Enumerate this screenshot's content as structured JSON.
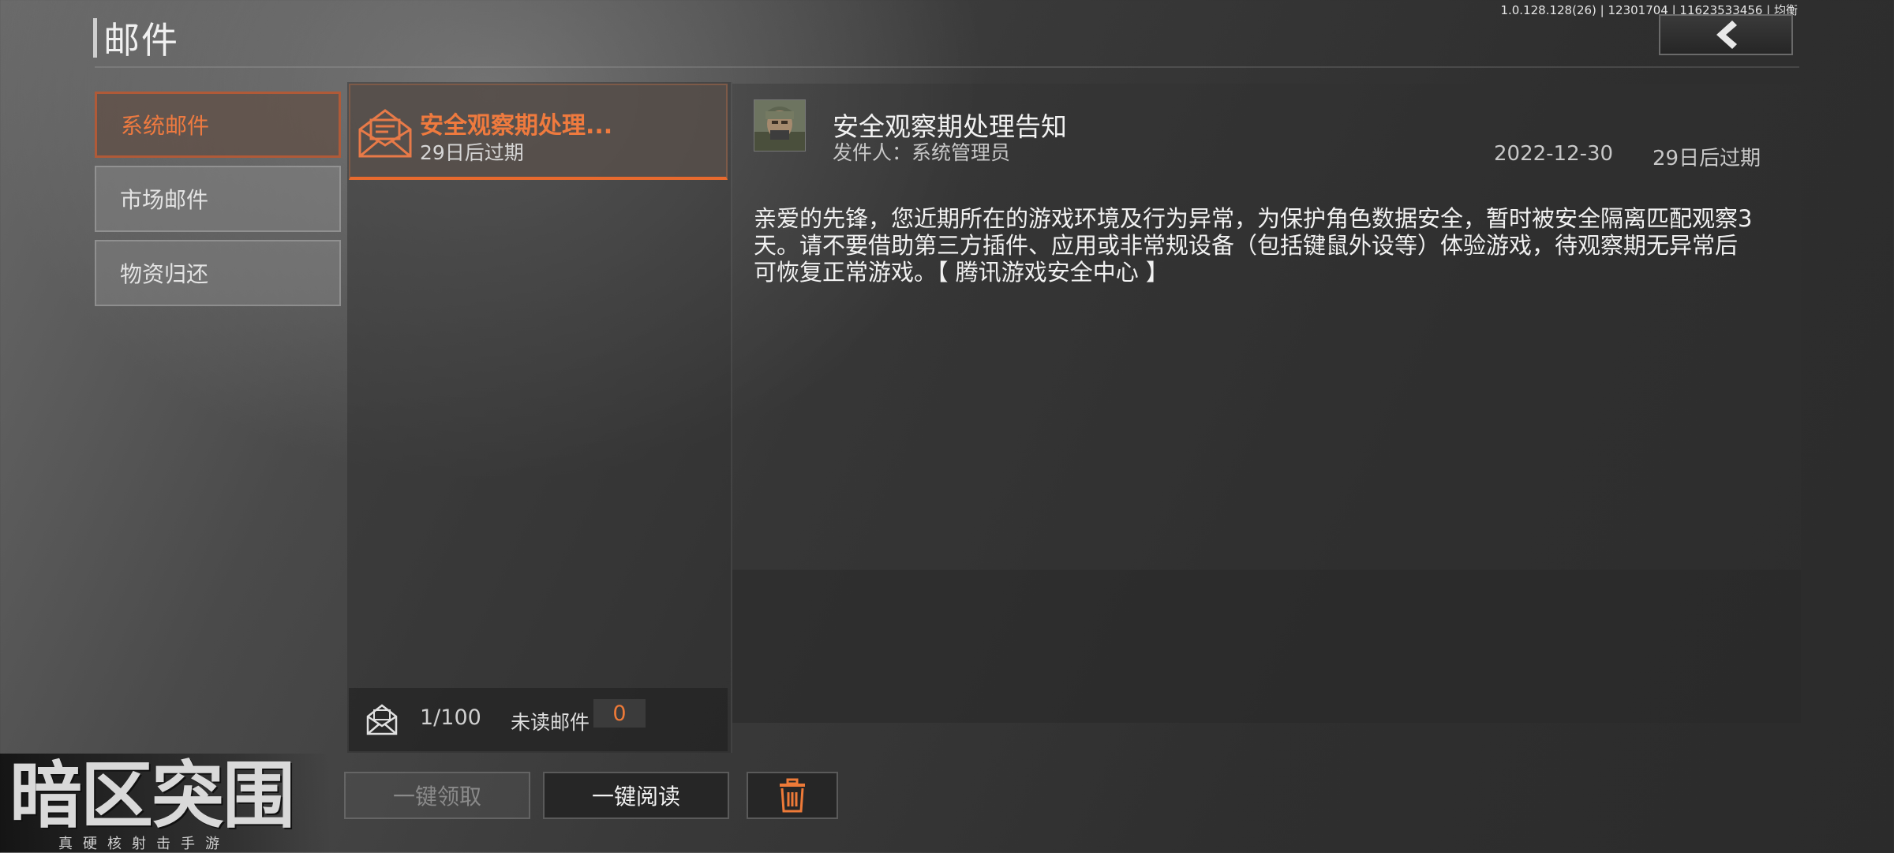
{
  "header": {
    "title": "邮件",
    "version": "1.0.128.128(26) | 12301704 | 11623533456 | 均衡"
  },
  "tabs": [
    {
      "label": "系统邮件",
      "active": true
    },
    {
      "label": "市场邮件",
      "active": false
    },
    {
      "label": "物资归还",
      "active": false
    }
  ],
  "mail_list": {
    "items": [
      {
        "title": "安全观察期处理...",
        "expiry": "29日后过期",
        "selected": true
      }
    ],
    "footer": {
      "count": "1/100",
      "unread_label": "未读邮件",
      "unread_count": "0"
    }
  },
  "detail": {
    "title": "安全观察期处理告知",
    "sender": "发件人：系统管理员",
    "date": "2022-12-30",
    "expiry": "29日后过期",
    "body": "亲爱的先锋，您近期所在的游戏环境及行为异常，为保护角色数据安全，暂时被安全隔离匹配观察3天。请不要借助第三方插件、应用或非常规设备（包括键鼠外设等）体验游戏，待观察期无异常后可恢复正常游戏。【 腾讯游戏安全中心 】"
  },
  "actions": {
    "claim_all": "一键领取",
    "read_all": "一键阅读"
  },
  "logo": {
    "main": "暗区突围",
    "sub": "真硬核射击手游"
  },
  "colors": {
    "accent": "#ee7a40",
    "active_border": "#b05a38",
    "panel_dark": "#262626"
  },
  "icons": [
    "back-chevron-icon",
    "envelope-open-icon",
    "envelope-icon",
    "trash-icon"
  ]
}
